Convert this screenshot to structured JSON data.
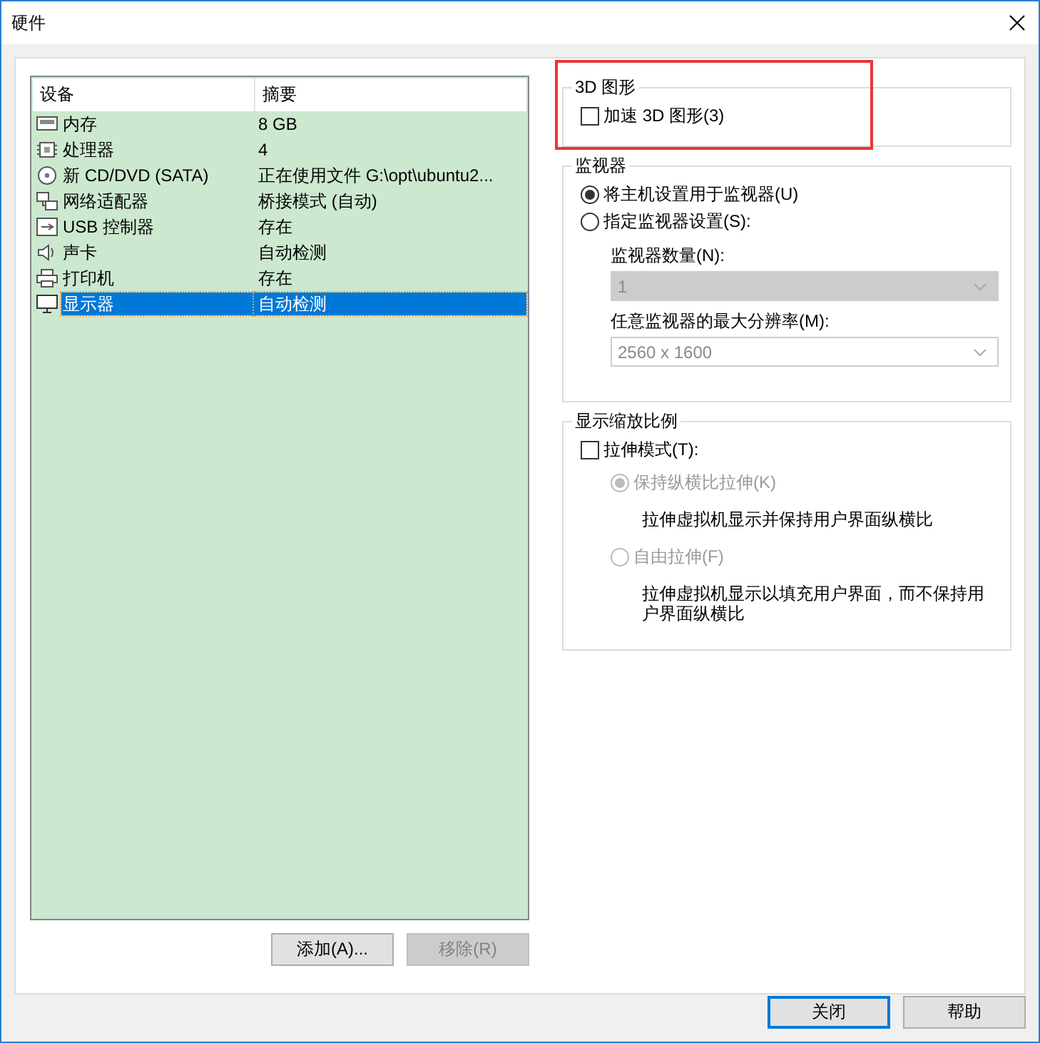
{
  "window": {
    "title": "硬件"
  },
  "devices": {
    "columns": [
      "设备",
      "摘要"
    ],
    "rows": [
      {
        "kind": "memory",
        "name": "内存",
        "summary": "8 GB",
        "selected": false
      },
      {
        "kind": "cpu",
        "name": "处理器",
        "summary": "4",
        "selected": false
      },
      {
        "kind": "cd",
        "name": "新 CD/DVD (SATA)",
        "summary": "正在使用文件 G:\\opt\\ubuntu2...",
        "selected": false
      },
      {
        "kind": "network",
        "name": "网络适配器",
        "summary": "桥接模式 (自动)",
        "selected": false
      },
      {
        "kind": "usb",
        "name": "USB 控制器",
        "summary": "存在",
        "selected": false
      },
      {
        "kind": "sound",
        "name": "声卡",
        "summary": "自动检测",
        "selected": false
      },
      {
        "kind": "printer",
        "name": "打印机",
        "summary": "存在",
        "selected": false
      },
      {
        "kind": "display",
        "name": "显示器",
        "summary": "自动检测",
        "selected": true
      }
    ]
  },
  "device_buttons": [
    {
      "label": "添加(A)...",
      "disabled": false
    },
    {
      "label": "移除(R)",
      "disabled": true
    }
  ],
  "graphics_3d": {
    "title": "3D 图形",
    "highlighted": true,
    "accelerate": {
      "label": "加速 3D 图形(3)",
      "checked": false
    }
  },
  "monitors": {
    "title": "监视器",
    "options": [
      {
        "label": "将主机设置用于监视器(U)",
        "selected": true,
        "disabled": false
      },
      {
        "label": "指定监视器设置(S):",
        "selected": false,
        "disabled": false
      }
    ],
    "count": {
      "label": "监视器数量(N):",
      "value": "1",
      "disabled": true,
      "kind": "dropdown"
    },
    "resolution": {
      "label": "任意监视器的最大分辨率(M):",
      "value": "2560 x 1600",
      "disabled": true,
      "kind": "combo"
    }
  },
  "scaling": {
    "title": "显示缩放比例",
    "stretch": {
      "label": "拉伸模式(T):",
      "checked": false
    },
    "options": [
      {
        "label": "保持纵横比拉伸(K)",
        "selected": true,
        "disabled": true,
        "description": "拉伸虚拟机显示并保持用户界面纵横比"
      },
      {
        "label": "自由拉伸(F)",
        "selected": false,
        "disabled": true,
        "description": "拉伸虚拟机显示以填充用户界面，而不保持用户界面纵横比"
      }
    ]
  },
  "footer_buttons": [
    {
      "label": "关闭",
      "default": true
    },
    {
      "label": "帮助",
      "default": false
    }
  ]
}
